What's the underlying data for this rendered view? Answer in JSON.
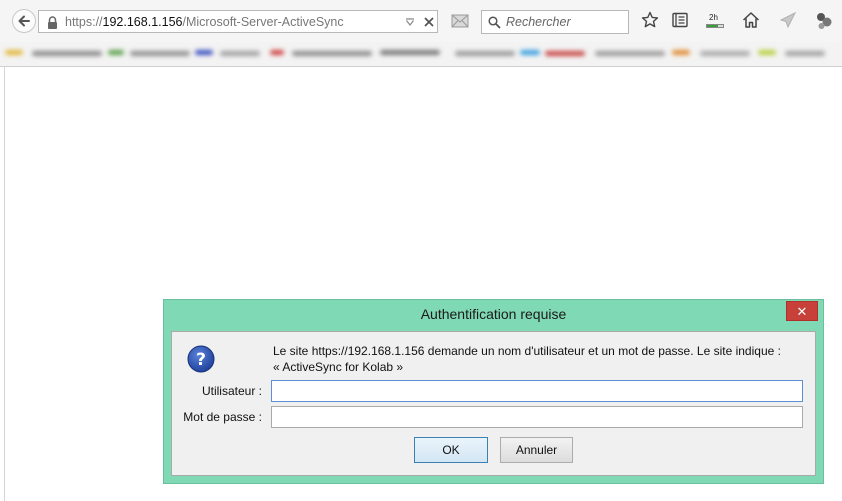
{
  "browser": {
    "url": {
      "prefix": "https://",
      "host": "192.168.1.156",
      "path": "/Microsoft-Server-ActiveSync"
    },
    "search_placeholder": "Rechercher",
    "timer_label": "2h",
    "timer_progress": 0.7
  },
  "dialog": {
    "title": "Authentification requise",
    "close_label": "✕",
    "message_line1": "Le site https://192.168.1.156 demande un nom d'utilisateur et un mot de passe. Le site indique :",
    "message_line2": "« ActiveSync for Kolab »",
    "username_label": "Utilisateur :",
    "username_value": "",
    "password_label": "Mot de passe :",
    "password_value": "",
    "ok_label": "OK",
    "cancel_label": "Annuler"
  },
  "colors": {
    "dialog_frame": "#7fd9b4",
    "close_button": "#c7403a",
    "focus_border": "#5d8fd6"
  }
}
